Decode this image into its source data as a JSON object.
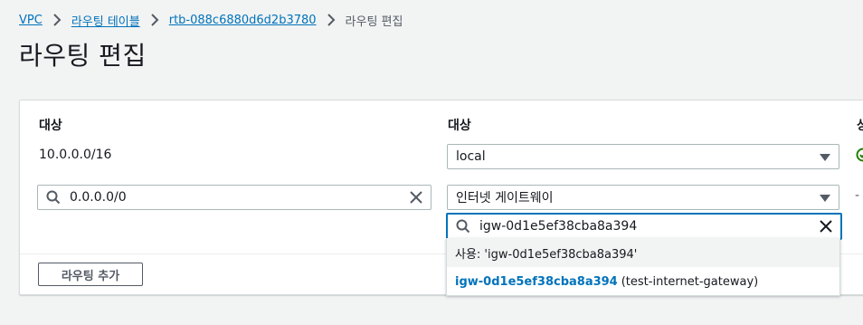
{
  "breadcrumb": {
    "items": [
      "VPC",
      "라우팅 테이블",
      "rtb-088c6880d6d2b3780"
    ],
    "current": "라우팅 편집"
  },
  "page": {
    "title": "라우팅 편집"
  },
  "routes": {
    "destination_header": "대상",
    "target_header": "대상",
    "status_header_partial": "상",
    "rows": [
      {
        "destination": "10.0.0.0/16",
        "target": "local",
        "status": "active"
      },
      {
        "destination": "0.0.0.0/0",
        "target": "인터넷 게이트웨이",
        "status": "-"
      }
    ],
    "add_label": "라우팅 추가"
  },
  "target_search": {
    "value": "igw-0d1e5ef38cba8a394",
    "use_option": "사용: 'igw-0d1e5ef38cba8a394'",
    "match_id": "igw-0d1e5ef38cba8a394",
    "match_name": "(test-internet-gateway)"
  },
  "colors": {
    "link": "#0073bb",
    "focus": "#0073bb",
    "success": "#1d8102"
  }
}
